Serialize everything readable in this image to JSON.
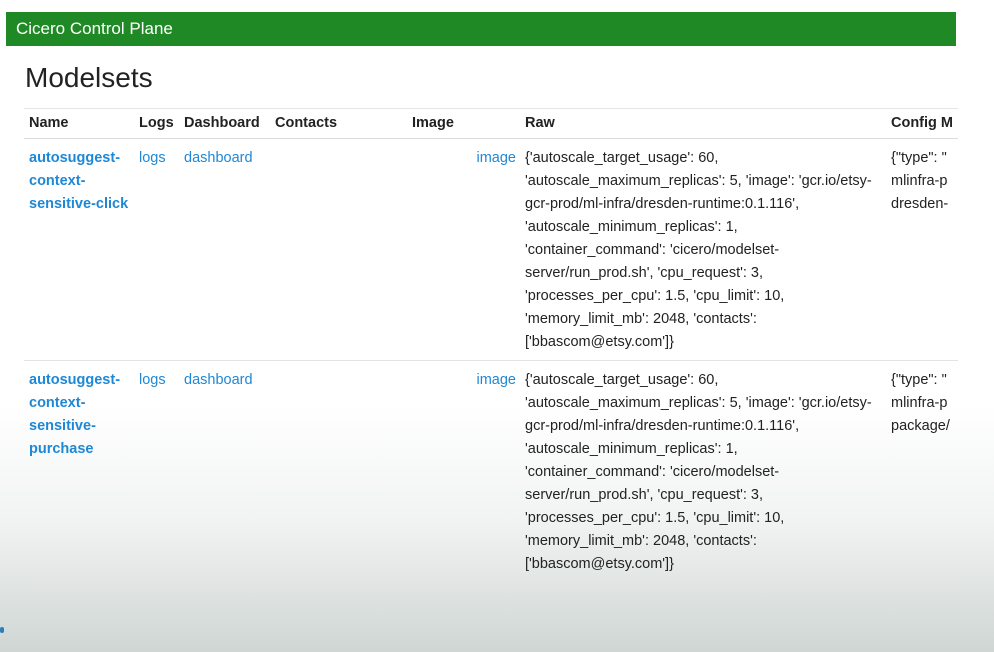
{
  "app": {
    "brand": "Cicero Control Plane"
  },
  "page": {
    "title": "Modelsets"
  },
  "table": {
    "columns": {
      "name": "Name",
      "logs": "Logs",
      "dashboard": "Dashboard",
      "contacts": "Contacts",
      "image": "Image",
      "raw": "Raw",
      "config": "Config M"
    },
    "rows": [
      {
        "name": "autosuggest-context-sensitive-click",
        "logs": "logs",
        "dashboard": "dashboard",
        "contacts": "",
        "image": "image",
        "raw": "{'autoscale_target_usage': 60, 'autoscale_maximum_replicas': 5, 'image': 'gcr.io/etsy-gcr-prod/ml-infra/dresden-runtime:0.1.116', 'autoscale_minimum_replicas': 1, 'container_command': 'cicero/modelset-server/run_prod.sh', 'cpu_request': 3, 'processes_per_cpu': 1.5, 'cpu_limit': 10, 'memory_limit_mb': 2048, 'contacts': ['bbascom@etsy.com']}",
        "config": "{\"type\": \"\nmlinfra-p\ndresden-"
      },
      {
        "name": "autosuggest-context-sensitive-purchase",
        "logs": "logs",
        "dashboard": "dashboard",
        "contacts": "",
        "image": "image",
        "raw": "{'autoscale_target_usage': 60, 'autoscale_maximum_replicas': 5, 'image': 'gcr.io/etsy-gcr-prod/ml-infra/dresden-runtime:0.1.116', 'autoscale_minimum_replicas': 1, 'container_command': 'cicero/modelset-server/run_prod.sh', 'cpu_request': 3, 'processes_per_cpu': 1.5, 'cpu_limit': 10, 'memory_limit_mb': 2048, 'contacts': ['bbascom@etsy.com']}",
        "config": "{\"type\": \"\nmlinfra-p\npackage/"
      }
    ]
  },
  "colors": {
    "navbar": "#1f8a25",
    "link": "#1e88d6",
    "text": "#222222"
  }
}
